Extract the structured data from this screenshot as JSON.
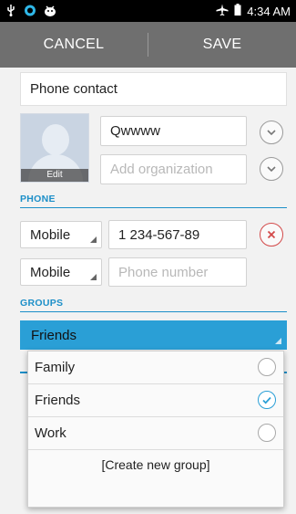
{
  "status_bar": {
    "time": "4:34 AM",
    "icons": [
      "usb-icon",
      "sync-icon",
      "android-icon",
      "airplane-icon",
      "battery-icon"
    ]
  },
  "action_bar": {
    "cancel_label": "CANCEL",
    "save_label": "SAVE"
  },
  "account": {
    "label": "Phone contact"
  },
  "avatar": {
    "edit_label": "Edit"
  },
  "name": {
    "value": "Qwwww"
  },
  "organization": {
    "placeholder": "Add organization"
  },
  "phone": {
    "section_label": "PHONE",
    "rows": [
      {
        "type": "Mobile",
        "value": "1 234-567-89",
        "placeholder": ""
      },
      {
        "type": "Mobile",
        "value": "",
        "placeholder": "Phone number"
      }
    ]
  },
  "groups": {
    "section_label": "GROUPS",
    "selected": "Friends",
    "options": [
      {
        "label": "Family",
        "checked": false
      },
      {
        "label": "Friends",
        "checked": true
      },
      {
        "label": "Work",
        "checked": false
      }
    ],
    "create_label": "[Create new group]"
  },
  "colors": {
    "accent": "#1c8fc8",
    "selected_bg": "#2a9fd6",
    "action_bar": "#6f6f6f",
    "remove": "#d34a4a"
  }
}
